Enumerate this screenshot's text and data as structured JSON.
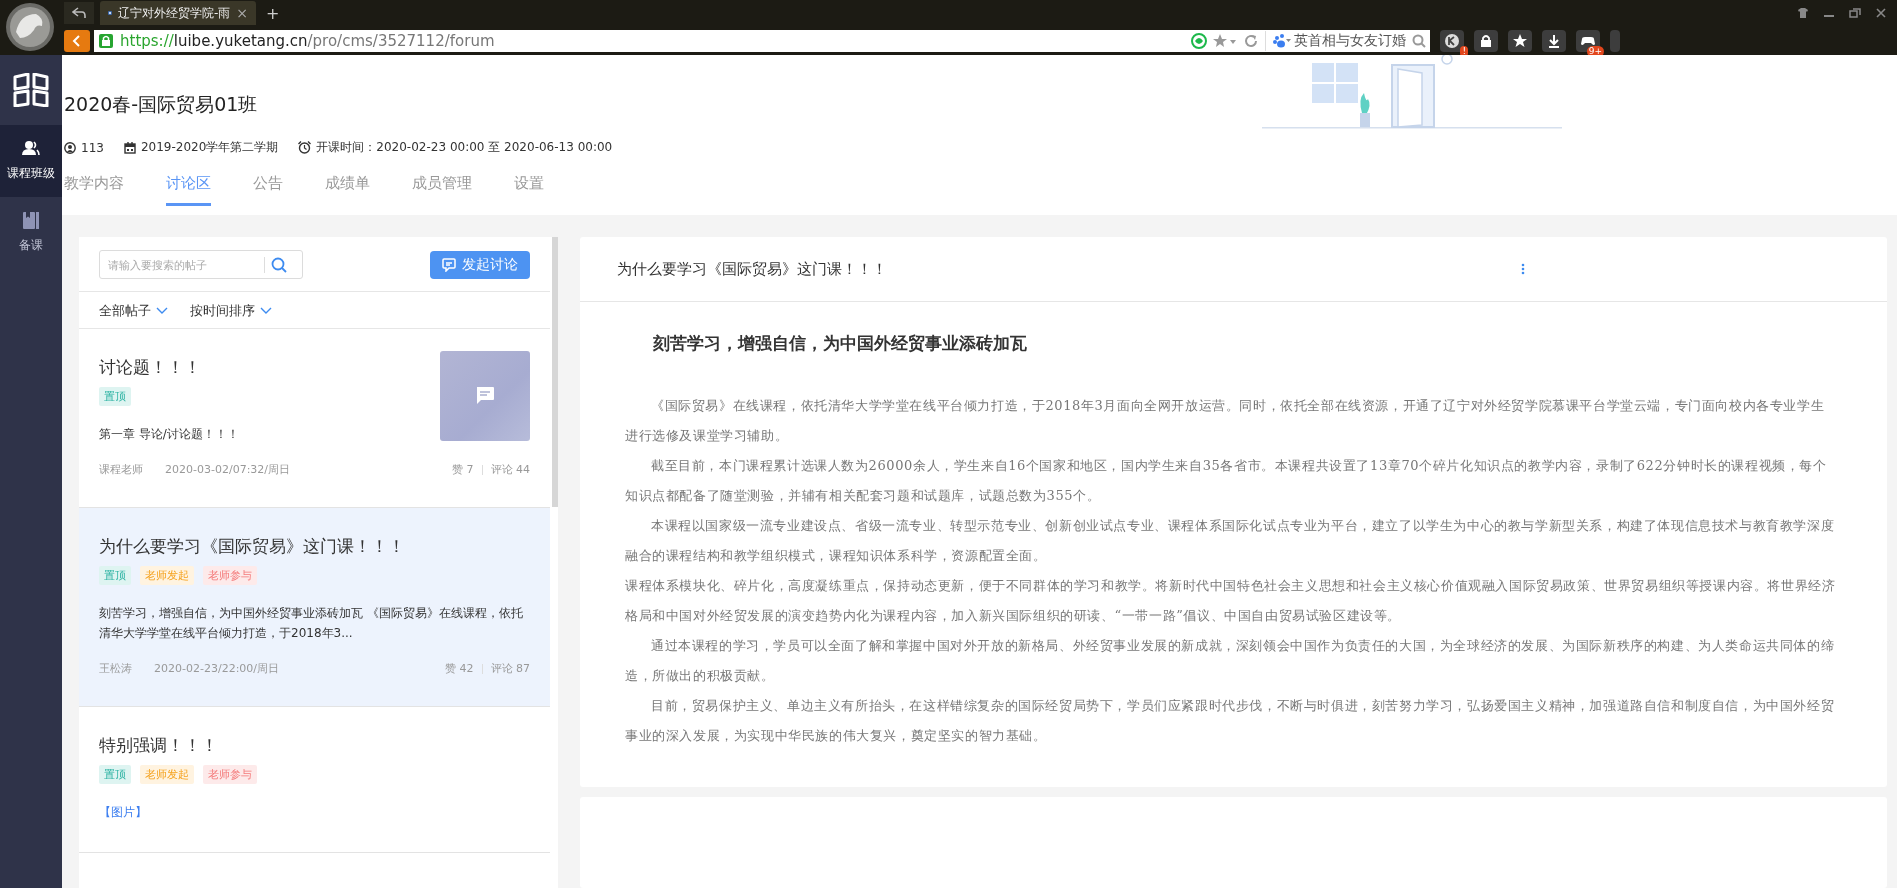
{
  "browser": {
    "tab_title": "辽宁对外经贸学院-雨",
    "tab_close": "×",
    "new_tab": "+",
    "url": {
      "scheme": "https://",
      "host": "luibe.yuketang.cn",
      "path": "/pro/cms/3527112/forum"
    },
    "search_text": "英首相与女友订婚",
    "toolbar_badges": [
      {
        "kind": "k",
        "badge": "!"
      },
      {
        "kind": "lock"
      },
      {
        "kind": "star"
      },
      {
        "kind": "download"
      },
      {
        "kind": "game",
        "badge": "9+"
      }
    ]
  },
  "sidebar": {
    "items": [
      {
        "label": "课程班级",
        "kind": "people",
        "selected": true
      },
      {
        "label": "备课",
        "kind": "book",
        "selected": false
      }
    ]
  },
  "course": {
    "title": "2020春-国际贸易01班",
    "students": "113",
    "term": "2019-2020学年第二学期",
    "schedule": "开课时间：2020-02-23 00:00 至 2020-06-13 00:00"
  },
  "tabs": [
    {
      "label": "教学内容",
      "selected": false
    },
    {
      "label": "讨论区",
      "selected": true
    },
    {
      "label": "公告",
      "selected": false
    },
    {
      "label": "成绩单",
      "selected": false
    },
    {
      "label": "成员管理",
      "selected": false
    },
    {
      "label": "设置",
      "selected": false
    }
  ],
  "forum": {
    "search": {
      "placeholder": "请输入要搜索的帖子"
    },
    "new_button": "发起讨论",
    "filters": [
      "全部帖子",
      "按时间排序"
    ],
    "posts": [
      {
        "title": "讨论题！！！",
        "tags": [
          {
            "label": "置顶",
            "kind": "pinned"
          }
        ],
        "excerpt": "第一章 导论/讨论题！！！",
        "excerpt_link": false,
        "thumbnail": true,
        "author": "课程老师",
        "time": "2020-03-02/07:32/周日",
        "likes": "赞 7",
        "comments": "评论 44",
        "selected": false
      },
      {
        "title": "为什么要学习《国际贸易》这门课！！！",
        "tags": [
          {
            "label": "置顶",
            "kind": "pinned"
          },
          {
            "label": "老师发起",
            "kind": "starter"
          },
          {
            "label": "老师参与",
            "kind": "joined"
          }
        ],
        "excerpt": "刻苦学习，增强自信，为中国外经贸事业添砖加瓦 《国际贸易》在线课程，依托清华大学学堂在线平台倾力打造，于2018年3...",
        "excerpt_link": false,
        "thumbnail": false,
        "author": "王松涛",
        "time": "2020-02-23/22:00/周日",
        "likes": "赞 42",
        "comments": "评论 87",
        "selected": true
      },
      {
        "title": "特别强调！！！",
        "tags": [
          {
            "label": "置顶",
            "kind": "pinned"
          },
          {
            "label": "老师发起",
            "kind": "starter"
          },
          {
            "label": "老师参与",
            "kind": "joined"
          }
        ],
        "excerpt": "【图片】",
        "excerpt_link": true,
        "thumbnail": false,
        "selected": false
      }
    ]
  },
  "article": {
    "title": "为什么要学习《国际贸易》这门课！！！",
    "heading": "刻苦学习，增强自信，为中国外经贸事业添砖加瓦",
    "paragraphs": [
      {
        "text": "《国际贸易》在线课程，依托清华大学学堂在线平台倾力打造，于2018年3月面向全网开放运营。同时，依托全部在线资源，开通了辽宁对外经贸学院慕课平台学堂云端，专门面向校内各专业学生进行选修及课堂学习辅助。",
        "indent": true
      },
      {
        "text": "截至目前，本门课程累计选课人数为26000余人，学生来自16个国家和地区，国内学生来自35各省市。本课程共设置了13章70个碎片化知识点的教学内容，录制了622分钟时长的课程视频，每个知识点都配备了随堂测验，并辅有相关配套习题和试题库，试题总数为355个。",
        "indent": true
      },
      {
        "text": "本课程以国家级一流专业建设点、省级一流专业、转型示范专业、创新创业试点专业、课程体系国际化试点专业为平台，建立了以学生为中心的教与学新型关系，构建了体现信息技术与教育教学深度融合的课程结构和教学组织模式，课程知识体系科学，资源配置全面。",
        "indent": true
      },
      {
        "text": "课程体系模块化、碎片化，高度凝练重点，保持动态更新，便于不同群体的学习和教学。将新时代中国特色社会主义思想和社会主义核心价值观融入国际贸易政策、世界贸易组织等授课内容。将世界经济格局和中国对外经贸发展的演变趋势内化为课程内容，加入新兴国际组织的研读、“一带一路”倡议、中国自由贸易试验区建设等。",
        "indent": false
      },
      {
        "text": "通过本课程的学习，学员可以全面了解和掌握中国对外开放的新格局、外经贸事业发展的新成就，深刻领会中国作为负责任的大国，为全球经济的发展、为国际新秩序的构建、为人类命运共同体的缔造，所做出的积极贡献。",
        "indent": true
      },
      {
        "text": "目前，贸易保护主义、单边主义有所抬头，在这样错综复杂的国际经贸局势下，学员们应紧跟时代步伐，不断与时俱进，刻苦努力学习，弘扬爱国主义精神，加强道路自信和制度自信，为中国外经贸事业的深入发展，为实现中华民族的伟大复兴，奠定坚实的智力基础。",
        "indent": true
      }
    ]
  }
}
